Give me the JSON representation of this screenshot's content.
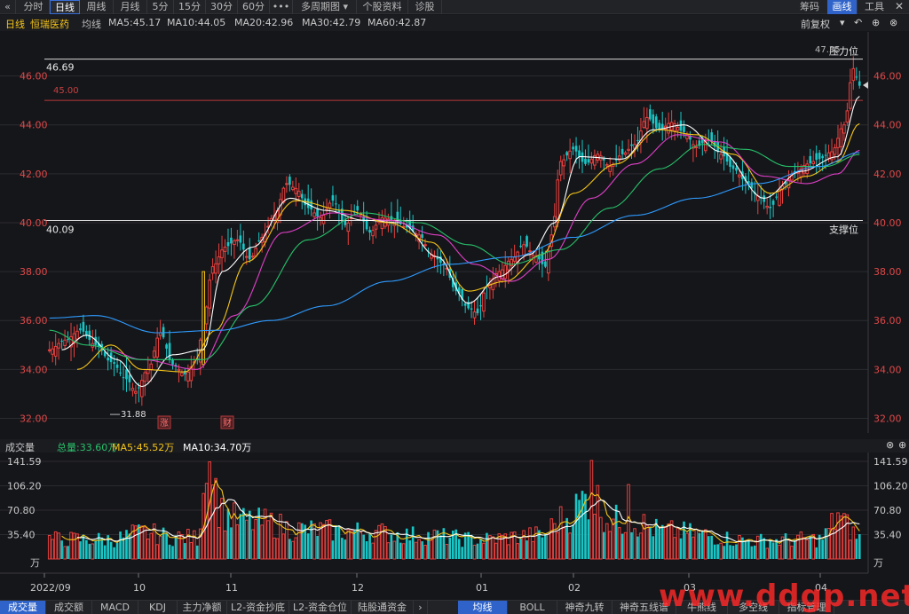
{
  "toolbar": {
    "back_icon": "chevron-left-icon",
    "tabs": [
      "分时",
      "日线",
      "周线",
      "月线",
      "5分",
      "15分",
      "30分",
      "60分",
      "•••",
      "多周期图",
      "个股资料",
      "诊股"
    ],
    "active_tab": "日线",
    "right": [
      "筹码",
      "画线",
      "工具"
    ]
  },
  "header": {
    "period": "日线",
    "stock_name": "恒瑞医药",
    "avg_label": "均线",
    "ma": [
      {
        "label": "MA5:45.17",
        "color": "#ffffff"
      },
      {
        "label": "MA10:44.05",
        "color": "#f5c518"
      },
      {
        "label": "MA20:42.96",
        "color": "#e040c8"
      },
      {
        "label": "MA30:42.79",
        "color": "#27c26a"
      },
      {
        "label": "MA60:42.87",
        "color": "#2e9bff"
      }
    ],
    "adjust": "前复权"
  },
  "price_panel": {
    "y_ticks": [
      "46.00",
      "44.00",
      "42.00",
      "40.00",
      "38.00",
      "36.00",
      "34.00",
      "32.00"
    ],
    "resistance_value": "46.69",
    "resistance_label": "压力位",
    "support_value": "40.09",
    "support_label": "支撑位",
    "red_line_value": "45.00",
    "high_label": "47.35",
    "low_label": "31.88",
    "markers": [
      "涨",
      "财"
    ]
  },
  "volume_panel": {
    "title": "成交量",
    "total": "总量:33.60万",
    "ma5": "MA5:45.52万",
    "ma10": "MA10:34.70万",
    "y_ticks": [
      "141.59",
      "106.20",
      "70.80",
      "35.40"
    ],
    "unit": "万",
    "x_ticks": [
      "2022/09",
      "10",
      "11",
      "12",
      "01",
      "02",
      "03",
      "04"
    ]
  },
  "bottom_tabs": {
    "left": [
      "成交量",
      "成交额",
      "MACD",
      "KDJ",
      "主力净额",
      "L2-资金抄底",
      "L2-资金仓位",
      "陆股通资金"
    ],
    "right": [
      "均线",
      "BOLL",
      "神奇九转",
      "神奇五线谱",
      "牛熊线",
      "多空线",
      "指标管理"
    ],
    "active_left": "成交量",
    "active_right": "均线"
  },
  "watermark": "www.ddgp.net",
  "chart_data": [
    {
      "type": "candlestick",
      "title": "恒瑞医药 日线",
      "ylim": [
        31.4,
        47.8
      ],
      "resistance": 46.69,
      "support": 40.09,
      "reference": 45.0,
      "anchors_close": [
        [
          0,
          34.8
        ],
        [
          5,
          35.2
        ],
        [
          10,
          35.6
        ],
        [
          15,
          35.0
        ],
        [
          20,
          34.3
        ],
        [
          25,
          33.6
        ],
        [
          28,
          33.1
        ],
        [
          32,
          34.0
        ],
        [
          36,
          35.5
        ],
        [
          40,
          34.2
        ],
        [
          44,
          33.8
        ],
        [
          48,
          34.4
        ],
        [
          50,
          36.0
        ],
        [
          53,
          38.2
        ],
        [
          57,
          39.0
        ],
        [
          61,
          39.3
        ],
        [
          65,
          38.5
        ],
        [
          69,
          39.4
        ],
        [
          73,
          40.3
        ],
        [
          77,
          41.6
        ],
        [
          80,
          41.4
        ],
        [
          84,
          40.6
        ],
        [
          88,
          40.2
        ],
        [
          92,
          40.9
        ],
        [
          96,
          39.9
        ],
        [
          100,
          40.5
        ],
        [
          104,
          39.6
        ],
        [
          108,
          40.2
        ],
        [
          112,
          40.1
        ],
        [
          116,
          39.8
        ],
        [
          120,
          39.5
        ],
        [
          124,
          38.7
        ],
        [
          128,
          38.3
        ],
        [
          132,
          37.2
        ],
        [
          136,
          36.5
        ],
        [
          139,
          36.3
        ],
        [
          142,
          37.4
        ],
        [
          146,
          38.0
        ],
        [
          150,
          38.5
        ],
        [
          154,
          39.1
        ],
        [
          158,
          38.6
        ],
        [
          161,
          38.2
        ],
        [
          163,
          39.5
        ],
        [
          166,
          42.5
        ],
        [
          170,
          43.0
        ],
        [
          174,
          42.4
        ],
        [
          178,
          42.8
        ],
        [
          182,
          42.3
        ],
        [
          186,
          42.8
        ],
        [
          190,
          43.2
        ],
        [
          194,
          44.3
        ],
        [
          198,
          43.8
        ],
        [
          202,
          44.1
        ],
        [
          206,
          43.7
        ],
        [
          210,
          43.1
        ],
        [
          214,
          43.4
        ],
        [
          218,
          42.8
        ],
        [
          222,
          42.2
        ],
        [
          226,
          41.7
        ],
        [
          230,
          41.1
        ],
        [
          234,
          40.6
        ],
        [
          238,
          41.5
        ],
        [
          242,
          42.0
        ],
        [
          246,
          42.4
        ],
        [
          250,
          42.6
        ],
        [
          254,
          42.9
        ],
        [
          258,
          44.0
        ],
        [
          261,
          46.3
        ],
        [
          263,
          45.6
        ]
      ],
      "ma_series": [
        {
          "name": "MA5",
          "color": "#ffffff",
          "anchors": [
            [
              4,
              34.8
            ],
            [
              12,
              35.4
            ],
            [
              22,
              34.4
            ],
            [
              30,
              33.3
            ],
            [
              40,
              34.6
            ],
            [
              50,
              34.8
            ],
            [
              56,
              38.0
            ],
            [
              66,
              39.0
            ],
            [
              78,
              41.0
            ],
            [
              90,
              40.5
            ],
            [
              102,
              40.1
            ],
            [
              114,
              40.0
            ],
            [
              126,
              38.6
            ],
            [
              136,
              36.7
            ],
            [
              146,
              37.8
            ],
            [
              156,
              38.7
            ],
            [
              164,
              40.0
            ],
            [
              172,
              42.7
            ],
            [
              186,
              42.6
            ],
            [
              196,
              43.8
            ],
            [
              206,
              44.0
            ],
            [
              218,
              42.9
            ],
            [
              232,
              41.0
            ],
            [
              244,
              42.1
            ],
            [
              256,
              42.7
            ],
            [
              263,
              45.17
            ]
          ]
        },
        {
          "name": "MA10",
          "color": "#f5c518",
          "anchors": [
            [
              9,
              34.0
            ],
            [
              20,
              35.0
            ],
            [
              30,
              34.0
            ],
            [
              44,
              33.9
            ],
            [
              54,
              35.6
            ],
            [
              64,
              38.4
            ],
            [
              80,
              40.9
            ],
            [
              96,
              40.5
            ],
            [
              110,
              40.0
            ],
            [
              124,
              39.2
            ],
            [
              136,
              37.2
            ],
            [
              148,
              37.6
            ],
            [
              160,
              38.7
            ],
            [
              170,
              41.2
            ],
            [
              184,
              42.4
            ],
            [
              198,
              43.8
            ],
            [
              210,
              43.6
            ],
            [
              222,
              42.8
            ],
            [
              234,
              41.2
            ],
            [
              246,
              41.9
            ],
            [
              256,
              42.5
            ],
            [
              263,
              44.05
            ]
          ]
        },
        {
          "name": "MA20",
          "color": "#e040c8",
          "anchors": [
            [
              19,
              34.8
            ],
            [
              30,
              34.4
            ],
            [
              48,
              34.0
            ],
            [
              60,
              36.2
            ],
            [
              76,
              39.6
            ],
            [
              92,
              40.4
            ],
            [
              110,
              40.1
            ],
            [
              126,
              39.5
            ],
            [
              138,
              38.3
            ],
            [
              150,
              37.6
            ],
            [
              162,
              38.5
            ],
            [
              176,
              41.0
            ],
            [
              190,
              42.4
            ],
            [
              204,
              43.6
            ],
            [
              218,
              43.3
            ],
            [
              232,
              41.9
            ],
            [
              246,
              41.6
            ],
            [
              256,
              42.0
            ],
            [
              263,
              42.96
            ]
          ]
        },
        {
          "name": "MA30",
          "color": "#27c26a",
          "anchors": [
            [
              0,
              35.6
            ],
            [
              12,
              35.0
            ],
            [
              30,
              34.4
            ],
            [
              50,
              34.4
            ],
            [
              66,
              36.6
            ],
            [
              84,
              39.3
            ],
            [
              102,
              40.4
            ],
            [
              120,
              40.0
            ],
            [
              136,
              39.1
            ],
            [
              150,
              38.3
            ],
            [
              166,
              38.9
            ],
            [
              182,
              40.6
            ],
            [
              198,
              42.2
            ],
            [
              212,
              43.2
            ],
            [
              226,
              43.0
            ],
            [
              240,
              42.3
            ],
            [
              252,
              42.3
            ],
            [
              263,
              42.79
            ]
          ]
        },
        {
          "name": "MA60",
          "color": "#2e9bff",
          "anchors": [
            [
              0,
              36.1
            ],
            [
              15,
              36.2
            ],
            [
              35,
              35.5
            ],
            [
              55,
              35.6
            ],
            [
              72,
              36.0
            ],
            [
              90,
              36.6
            ],
            [
              110,
              37.6
            ],
            [
              130,
              38.3
            ],
            [
              150,
              38.6
            ],
            [
              170,
              39.4
            ],
            [
              190,
              40.3
            ],
            [
              210,
              41.0
            ],
            [
              230,
              41.6
            ],
            [
              250,
              42.3
            ],
            [
              263,
              42.87
            ]
          ]
        }
      ]
    },
    {
      "type": "bar",
      "title": "成交量",
      "ylabel": "万",
      "ylim": [
        0,
        141.59
      ],
      "ma_series": [
        {
          "name": "MA5",
          "color": "#f5c518"
        },
        {
          "name": "MA10",
          "color": "#ffffff"
        }
      ]
    }
  ]
}
